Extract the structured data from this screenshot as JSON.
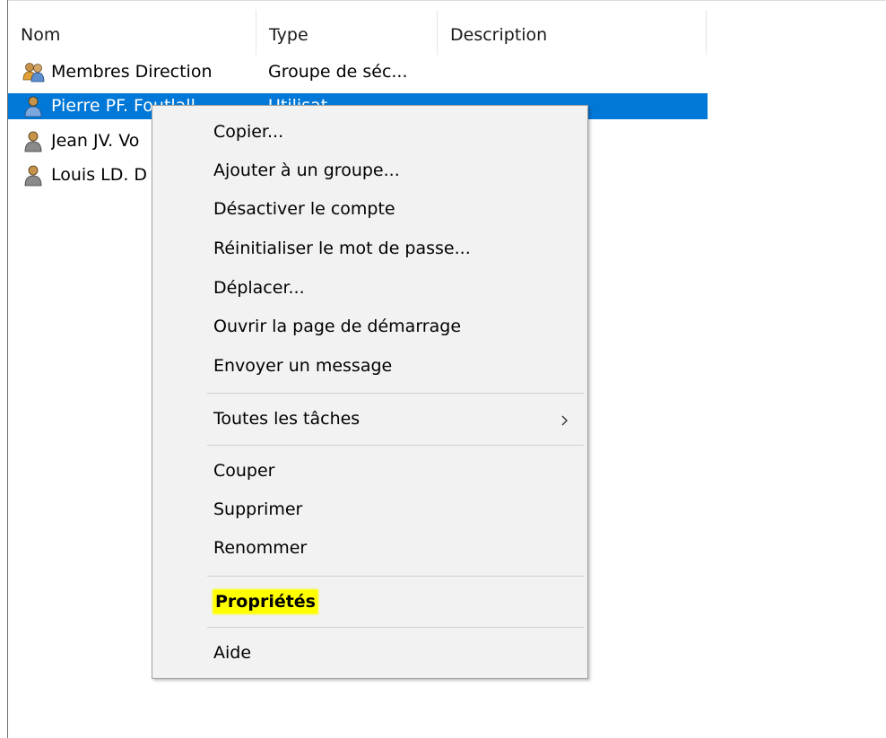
{
  "columns": {
    "name": "Nom",
    "type": "Type",
    "description": "Description"
  },
  "rows": [
    {
      "name": "Membres Direction",
      "type": "Groupe de séc...",
      "icon": "group-icon"
    },
    {
      "name": "Pierre PF. Foutlall",
      "type": "Utilisat",
      "icon": "user-icon"
    },
    {
      "name": "Jean JV. Vo",
      "type": "",
      "icon": "user-icon"
    },
    {
      "name": "Louis LD. D",
      "type": "",
      "icon": "user-icon"
    }
  ],
  "context_menu": {
    "items": [
      "Copier...",
      "Ajouter à un groupe...",
      "Désactiver le compte",
      "Réinitialiser le mot de passe...",
      "Déplacer...",
      "Ouvrir la page de démarrage",
      "Envoyer un message",
      "Toutes les tâches",
      "Couper",
      "Supprimer",
      "Renommer",
      "Propriétés",
      "Aide"
    ]
  },
  "colors": {
    "selection": "#0078d7",
    "highlight": "#ffff00",
    "menu_bg": "#f2f2f2"
  }
}
